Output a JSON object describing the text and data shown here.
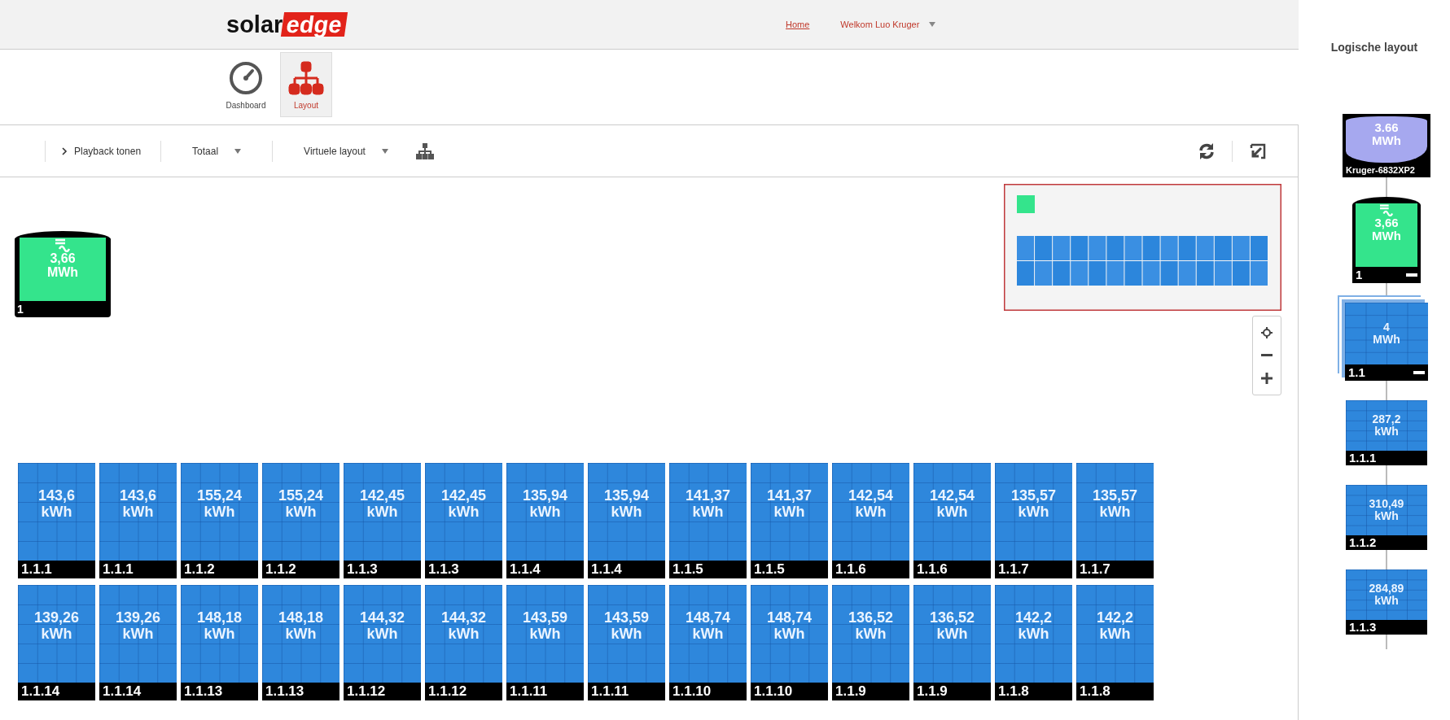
{
  "header": {
    "logo": {
      "text": "solar",
      "highlight": "edge"
    },
    "home_link": "Home",
    "user_menu": "Welkom Luo Kruger"
  },
  "nav": [
    {
      "label": "Dashboard",
      "selected": false
    },
    {
      "label": "Layout",
      "selected": true
    }
  ],
  "toolbar": {
    "playback": "Playback tonen",
    "dropdowns": [
      "Totaal",
      "Virtuele layout"
    ]
  },
  "canvas": {
    "inverter": {
      "energy": "3,66",
      "unit": "MWh",
      "id": "1"
    },
    "panel_rows": [
      [
        {
          "energy": "143,6",
          "unit": "kWh",
          "id": "1.1.1"
        },
        {
          "energy": "143,6",
          "unit": "kWh",
          "id": "1.1.1"
        },
        {
          "energy": "155,24",
          "unit": "kWh",
          "id": "1.1.2"
        },
        {
          "energy": "155,24",
          "unit": "kWh",
          "id": "1.1.2"
        },
        {
          "energy": "142,45",
          "unit": "kWh",
          "id": "1.1.3"
        },
        {
          "energy": "142,45",
          "unit": "kWh",
          "id": "1.1.3"
        },
        {
          "energy": "135,94",
          "unit": "kWh",
          "id": "1.1.4"
        },
        {
          "energy": "135,94",
          "unit": "kWh",
          "id": "1.1.4"
        },
        {
          "energy": "141,37",
          "unit": "kWh",
          "id": "1.1.5"
        },
        {
          "energy": "141,37",
          "unit": "kWh",
          "id": "1.1.5"
        },
        {
          "energy": "142,54",
          "unit": "kWh",
          "id": "1.1.6"
        },
        {
          "energy": "142,54",
          "unit": "kWh",
          "id": "1.1.6"
        },
        {
          "energy": "135,57",
          "unit": "kWh",
          "id": "1.1.7"
        },
        {
          "energy": "135,57",
          "unit": "kWh",
          "id": "1.1.7"
        }
      ],
      [
        {
          "energy": "139,26",
          "unit": "kWh",
          "id": "1.1.14"
        },
        {
          "energy": "139,26",
          "unit": "kWh",
          "id": "1.1.14"
        },
        {
          "energy": "148,18",
          "unit": "kWh",
          "id": "1.1.13"
        },
        {
          "energy": "148,18",
          "unit": "kWh",
          "id": "1.1.13"
        },
        {
          "energy": "144,32",
          "unit": "kWh",
          "id": "1.1.12"
        },
        {
          "energy": "144,32",
          "unit": "kWh",
          "id": "1.1.12"
        },
        {
          "energy": "143,59",
          "unit": "kWh",
          "id": "1.1.11"
        },
        {
          "energy": "143,59",
          "unit": "kWh",
          "id": "1.1.11"
        },
        {
          "energy": "148,74",
          "unit": "kWh",
          "id": "1.1.10"
        },
        {
          "energy": "148,74",
          "unit": "kWh",
          "id": "1.1.10"
        },
        {
          "energy": "136,52",
          "unit": "kWh",
          "id": "1.1.9"
        },
        {
          "energy": "136,52",
          "unit": "kWh",
          "id": "1.1.9"
        },
        {
          "energy": "142,2",
          "unit": "kWh",
          "id": "1.1.8"
        },
        {
          "energy": "142,2",
          "unit": "kWh",
          "id": "1.1.8"
        }
      ]
    ]
  },
  "logical_layout": {
    "title": "Logische layout",
    "nodes": [
      {
        "kind": "site",
        "energy": "3.66",
        "unit": "MWh",
        "id": "Kruger-6832XP2"
      },
      {
        "kind": "inverter",
        "energy": "3,66",
        "unit": "MWh",
        "id": "1"
      },
      {
        "kind": "string",
        "energy": "4",
        "unit": "MWh",
        "id": "1.1"
      },
      {
        "kind": "panel",
        "energy": "287,2",
        "unit": "kWh",
        "id": "1.1.1"
      },
      {
        "kind": "panel",
        "energy": "310,49",
        "unit": "kWh",
        "id": "1.1.2"
      },
      {
        "kind": "panel",
        "energy": "284,89",
        "unit": "kWh",
        "id": "1.1.3"
      }
    ]
  }
}
